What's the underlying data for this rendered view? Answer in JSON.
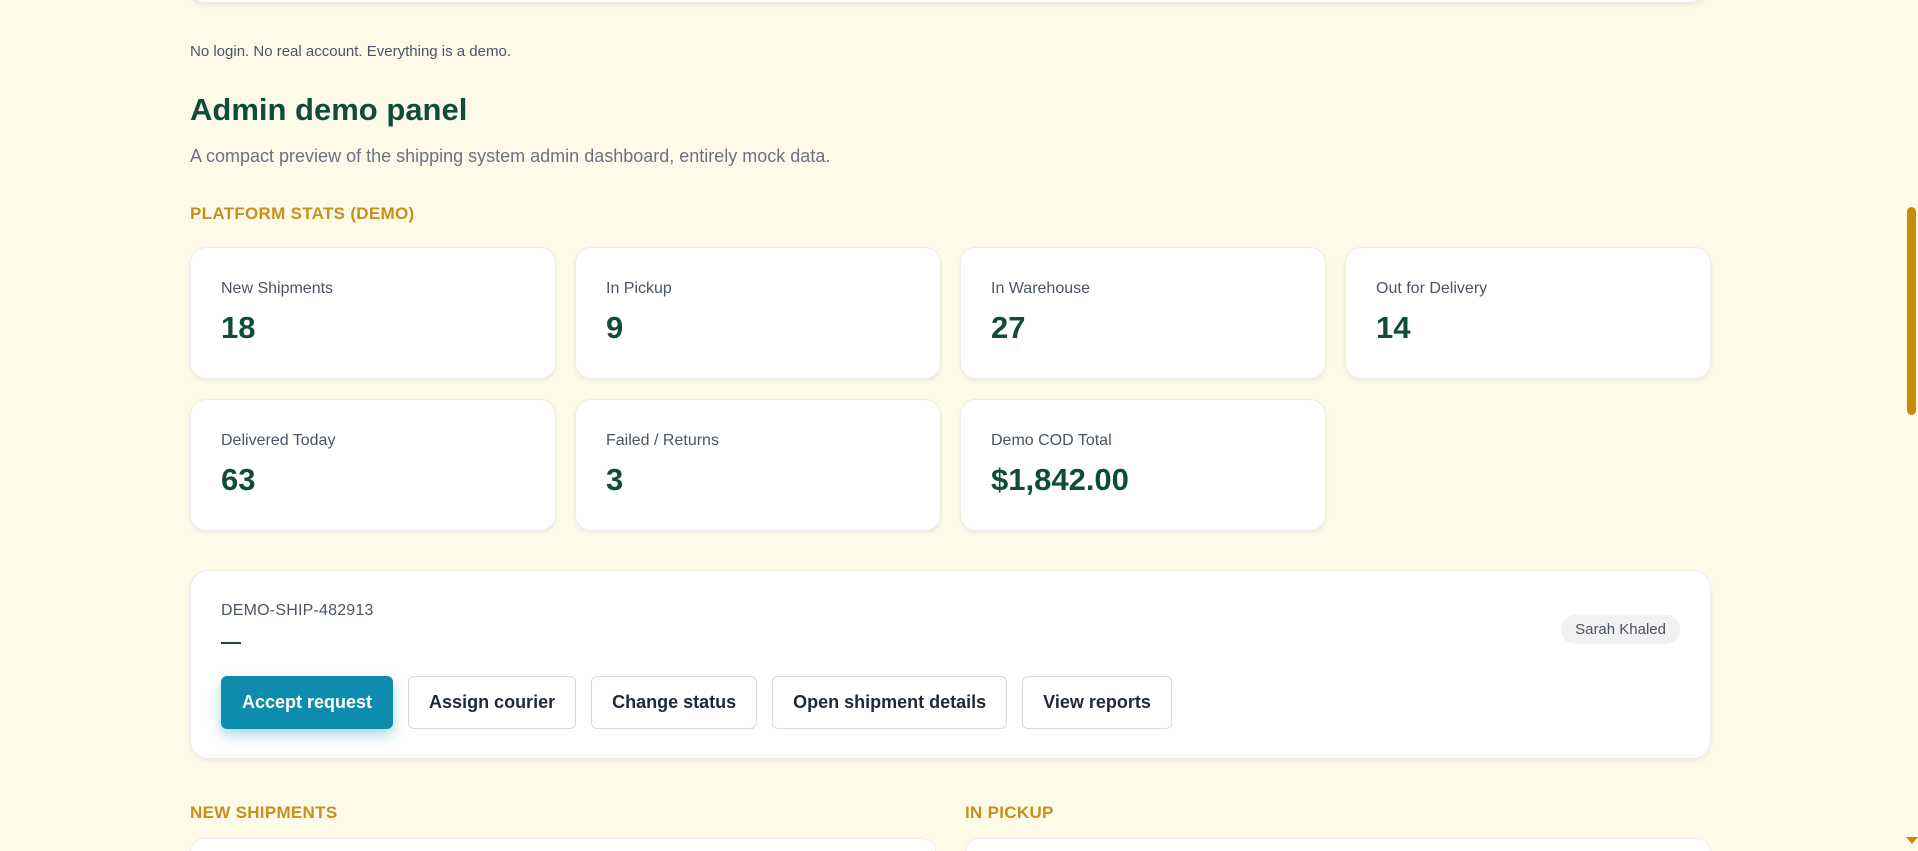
{
  "note": "No login. No real account. Everything is a demo.",
  "title": "Admin demo panel",
  "subtitle": "A compact preview of the shipping system admin dashboard, entirely mock data.",
  "stats_section": {
    "label": "PLATFORM STATS (DEMO)",
    "cards": [
      {
        "label": "New Shipments",
        "value": "18"
      },
      {
        "label": "In Pickup",
        "value": "9"
      },
      {
        "label": "In Warehouse",
        "value": "27"
      },
      {
        "label": "Out for Delivery",
        "value": "14"
      },
      {
        "label": "Delivered Today",
        "value": "63"
      },
      {
        "label": "Failed / Returns",
        "value": "3"
      },
      {
        "label": "Demo COD Total",
        "value": "$1,842.00"
      }
    ]
  },
  "shipment": {
    "id": "DEMO-SHIP-482913",
    "owner": "Sarah Khaled",
    "actions": {
      "accept": "Accept request",
      "assign": "Assign courier",
      "change_status": "Change status",
      "open_details": "Open shipment details",
      "view_reports": "View reports"
    }
  },
  "lower_sections": {
    "new_shipments": "NEW SHIPMENTS",
    "in_pickup": "IN PICKUP"
  },
  "colors": {
    "background": "#fdfae8",
    "accent": "#c8901a",
    "primary_text": "#0f4c3a",
    "primary_button": "#0e8cae"
  }
}
